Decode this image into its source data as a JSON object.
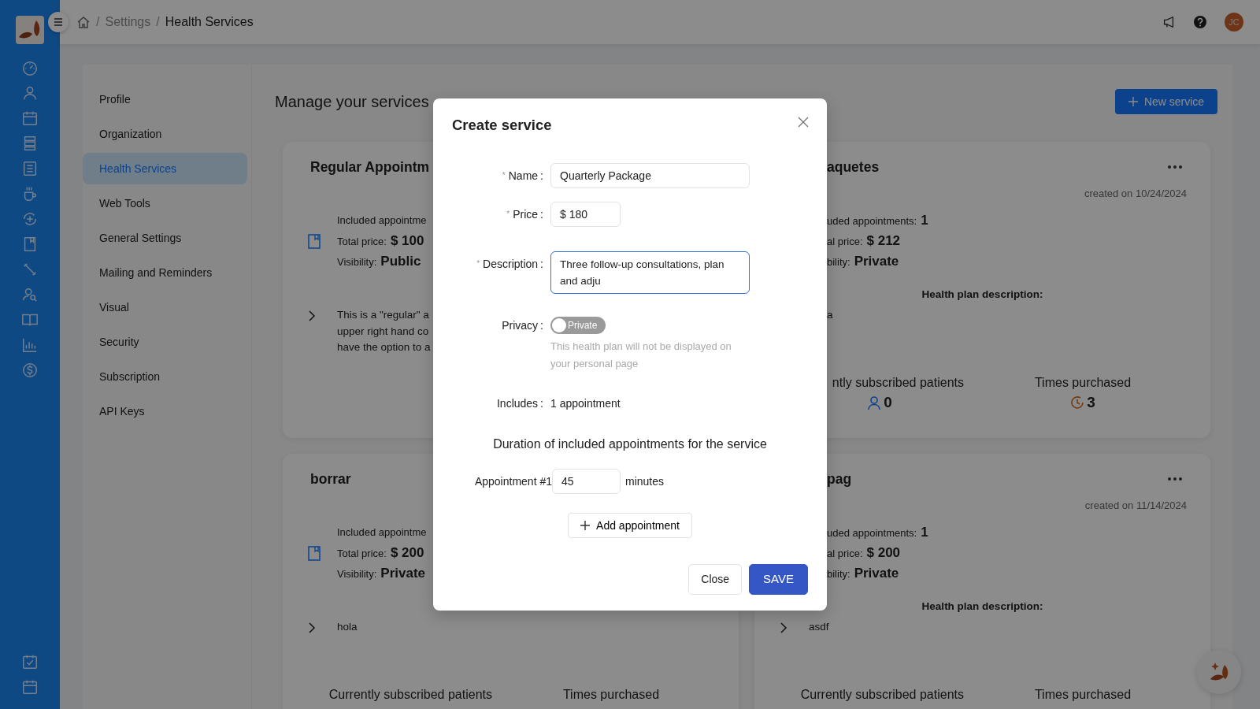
{
  "breadcrumb": [
    {
      "kind": "home"
    },
    {
      "kind": "separator",
      "text": "/"
    },
    {
      "kind": "link",
      "text": "Settings"
    },
    {
      "kind": "separator",
      "text": "/"
    },
    {
      "kind": "current",
      "text": "Health Services"
    }
  ],
  "user": {
    "initials": "JC"
  },
  "settings_menu": [
    {
      "label": "Profile",
      "selected": false
    },
    {
      "label": "Organization",
      "selected": false
    },
    {
      "label": "Health Services",
      "selected": true
    },
    {
      "label": "Web Tools",
      "selected": false
    },
    {
      "label": "General Settings",
      "selected": false
    },
    {
      "label": "Mailing and Reminders",
      "selected": false
    },
    {
      "label": "Visual",
      "selected": false
    },
    {
      "label": "Security",
      "selected": false
    },
    {
      "label": "Subscription",
      "selected": false
    },
    {
      "label": "API Keys",
      "selected": false
    }
  ],
  "page_title": "Manage your services",
  "new_service_button": {
    "label": "New service"
  },
  "cards": [
    {
      "title": "Regular Appointm",
      "info": [
        {
          "label": "Included appointme"
        },
        {
          "label": "Total price:",
          "value": "$ 100"
        },
        {
          "label": "Visibility:",
          "value": "Public"
        }
      ],
      "description": {
        "lines": [
          "This is a \"regular\" a",
          "upper right hand co",
          "have the option to a"
        ],
        "collapsed": true
      }
    },
    {
      "title": "aquetes",
      "created": "created on 10/24/2024",
      "info": [
        {
          "label": "uded appointments:",
          "value": "1"
        },
        {
          "label": "al price:",
          "value": "$ 212"
        },
        {
          "label": "bility:",
          "value": "Private"
        }
      ],
      "description_heading": "Health plan description:",
      "description": {
        "lines": [
          "a"
        ]
      },
      "stats": [
        {
          "kind": "patients",
          "label": "ntly subscribed patients",
          "value": "0"
        },
        {
          "kind": "purchases",
          "label": "Times purchased",
          "value": "3"
        }
      ]
    },
    {
      "title": "borrar",
      "info": [
        {
          "label": "Included appointme"
        },
        {
          "label": "Total price:",
          "value": "$ 200"
        },
        {
          "label": "Visibility:",
          "value": "Private"
        }
      ],
      "description": {
        "lines": [
          "hola"
        ],
        "collapsed": true
      },
      "stats": [
        {
          "kind": "patients",
          "label": "Currently subscribed patients"
        },
        {
          "kind": "purchases",
          "label": "Times purchased"
        }
      ]
    },
    {
      "title": "pag",
      "created": "created on 11/14/2024",
      "info": [
        {
          "label": "uded appointments:",
          "value": "1"
        },
        {
          "label": "al price:",
          "value": "$ 200"
        },
        {
          "label": "bility:",
          "value": "Private"
        }
      ],
      "description_heading": "Health plan description:",
      "description": {
        "lines": [
          "asdf"
        ],
        "collapsed": true
      },
      "stats": [
        {
          "kind": "patients",
          "label": "Currently subscribed patients"
        },
        {
          "kind": "purchases",
          "label": "Times purchased"
        }
      ]
    }
  ],
  "modal": {
    "title": "Create service",
    "fields": [
      {
        "kind": "input",
        "required_mark": "*",
        "label": "Name",
        "colon": ":",
        "value": "Quarterly Package"
      },
      {
        "kind": "short_input",
        "required_mark": "*",
        "label": "Price",
        "colon": ":",
        "value": "$ 180"
      },
      {
        "kind": "textarea",
        "required_mark": "*",
        "label": "Description",
        "colon": ":",
        "value": "Three follow-up consultations, plan and adju",
        "focused": true
      },
      {
        "kind": "toggle",
        "label": "Privacy",
        "colon": ":",
        "on": false,
        "toggle_text": "Private",
        "help": "This health plan will not be displayed on your personal page"
      },
      {
        "kind": "static",
        "label": "Includes",
        "colon": ":",
        "value": "1 appointment"
      }
    ],
    "duration_heading": "Duration of included appointments for the service",
    "appointments": [
      {
        "label": "Appointment #1",
        "value": "45",
        "unit": "minutes"
      }
    ],
    "add_button": "Add appointment",
    "buttons": [
      {
        "label": "Close",
        "kind": "secondary"
      },
      {
        "label": "SAVE",
        "kind": "primary"
      }
    ]
  }
}
